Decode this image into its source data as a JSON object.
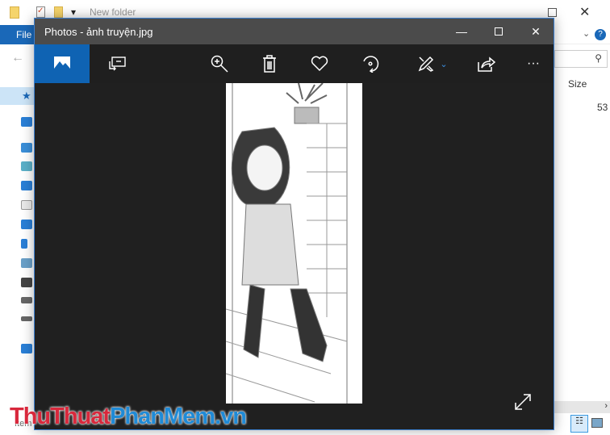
{
  "explorer": {
    "folder_title": "New folder",
    "file_tab": "File",
    "size_header": "Size",
    "size_value": "53",
    "status_left": "Item"
  },
  "photos": {
    "title": "Photos - ảnh truyện.jpg",
    "minimize": "—",
    "maximize": "☐",
    "close": "✕",
    "more": "···"
  },
  "watermark": {
    "part1": "ThuThuat",
    "part2": "PhanMem",
    "part3": ".vn"
  },
  "colors": {
    "accent": "#0f63b3",
    "titlebar": "#4b4b4b",
    "toolbar": "#1f1f1f"
  }
}
